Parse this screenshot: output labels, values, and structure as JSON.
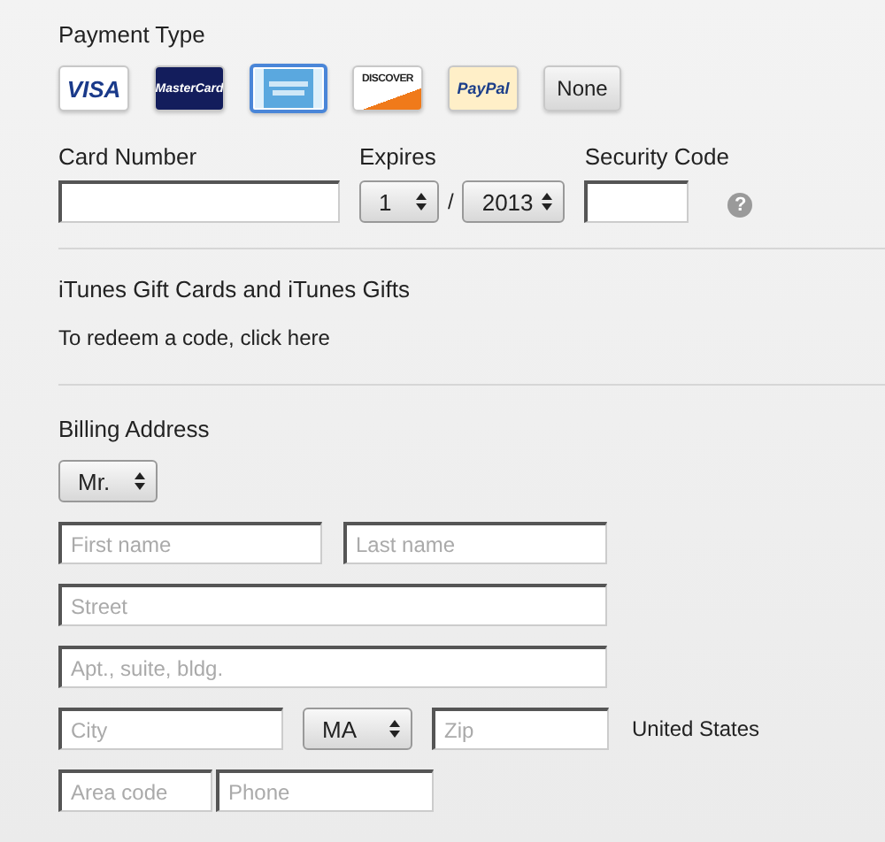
{
  "payment_type": {
    "title": "Payment Type",
    "options": [
      {
        "kind": "visa",
        "label": "VISA",
        "selected": false
      },
      {
        "kind": "mastercard",
        "label": "MasterCard",
        "selected": false
      },
      {
        "kind": "amex",
        "selected": true
      },
      {
        "kind": "discover",
        "label": "DISCOVER",
        "selected": false
      },
      {
        "kind": "paypal",
        "label": "PayPal",
        "selected": false
      },
      {
        "kind": "none",
        "label": "None",
        "selected": false
      }
    ]
  },
  "card": {
    "number_label": "Card Number",
    "expires_label": "Expires",
    "month": "1",
    "separator": "/",
    "year": "2013",
    "security_label": "Security Code",
    "help": "?"
  },
  "gifts": {
    "title": "iTunes Gift Cards and iTunes Gifts",
    "link": "To redeem a code, click here"
  },
  "billing": {
    "title": "Billing Address",
    "salutation": "Mr.",
    "first_name": {
      "placeholder": "First name"
    },
    "last_name": {
      "placeholder": "Last name"
    },
    "street": {
      "placeholder": "Street"
    },
    "apt": {
      "placeholder": "Apt., suite, bldg."
    },
    "city": {
      "placeholder": "City"
    },
    "state": "MA",
    "zip": {
      "placeholder": "Zip"
    },
    "country": "United States",
    "area_code": {
      "placeholder": "Area code"
    },
    "phone": {
      "placeholder": "Phone"
    }
  }
}
